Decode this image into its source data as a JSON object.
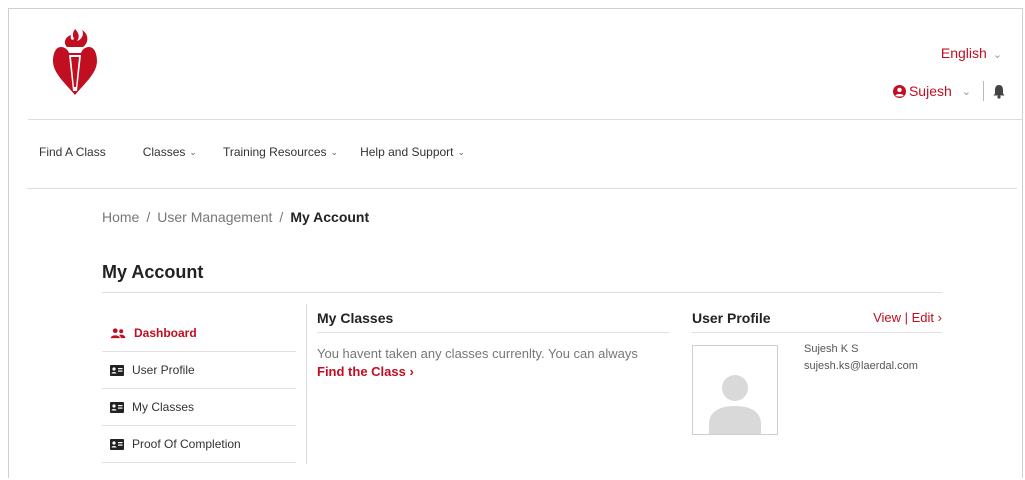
{
  "header": {
    "language": "English",
    "user_name": "Sujesh"
  },
  "nav": {
    "items": [
      {
        "label": "Find A Class"
      },
      {
        "label": "Classes"
      },
      {
        "label": "Training Resources"
      },
      {
        "label": "Help and Support"
      }
    ]
  },
  "breadcrumb": {
    "home": "Home",
    "section": "User Management",
    "current": "My Account"
  },
  "page": {
    "title": "My Account"
  },
  "sidebar": {
    "items": [
      {
        "label": "Dashboard",
        "active": true
      },
      {
        "label": "User Profile"
      },
      {
        "label": "My Classes"
      },
      {
        "label": "Proof Of Completion"
      }
    ]
  },
  "my_classes": {
    "title": "My Classes",
    "message": "You havent taken any classes currenlty. You can always",
    "link": "Find the Class"
  },
  "user_profile": {
    "title": "User Profile",
    "actions": "View | Edit",
    "name": "Sujesh K S",
    "email": "sujesh.ks@laerdal.com"
  },
  "colors": {
    "brand_red": "#c10e21"
  }
}
